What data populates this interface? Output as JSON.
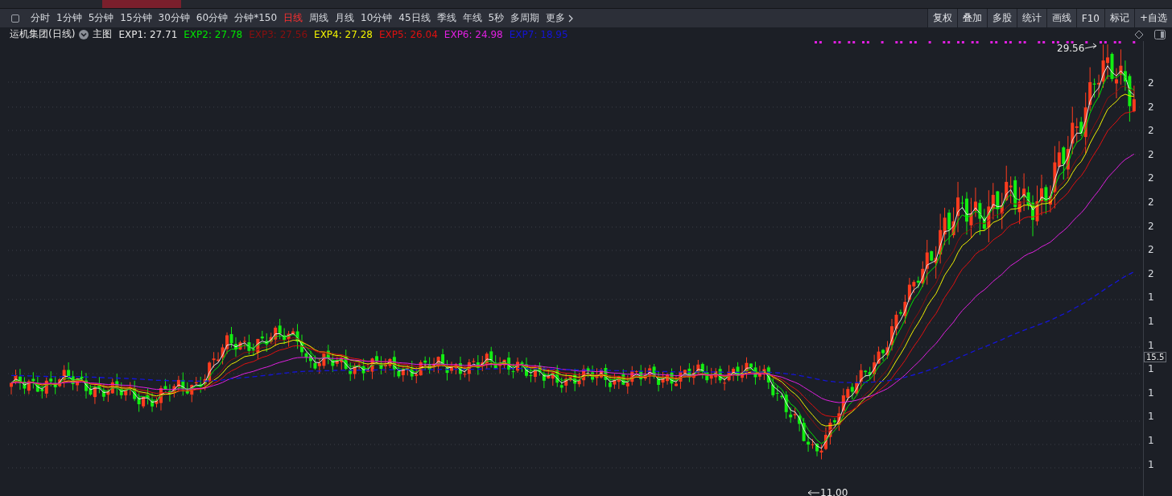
{
  "toolbar": {
    "periods": [
      {
        "label": "分时",
        "selected": false
      },
      {
        "label": "1分钟",
        "selected": false
      },
      {
        "label": "5分钟",
        "selected": false
      },
      {
        "label": "15分钟",
        "selected": false
      },
      {
        "label": "30分钟",
        "selected": false
      },
      {
        "label": "60分钟",
        "selected": false
      },
      {
        "label": "分钟*150",
        "selected": false
      },
      {
        "label": "日线",
        "selected": true
      },
      {
        "label": "周线",
        "selected": false
      },
      {
        "label": "月线",
        "selected": false
      },
      {
        "label": "10分钟",
        "selected": false
      },
      {
        "label": "45日线",
        "selected": false
      },
      {
        "label": "季线",
        "selected": false
      },
      {
        "label": "年线",
        "selected": false
      },
      {
        "label": "5秒",
        "selected": false
      },
      {
        "label": "多周期",
        "selected": false
      }
    ],
    "more": "更多",
    "buttons": [
      "复权",
      "叠加",
      "多股",
      "统计",
      "画线",
      "F10",
      "标记",
      "+自选"
    ]
  },
  "legend": {
    "title": "运机集团(日线)",
    "chart_label": "主图",
    "indicators": [
      {
        "text": "EXP1: 27.71",
        "color": "#e6e6e6"
      },
      {
        "text": "EXP2: 27.78",
        "color": "#00e600"
      },
      {
        "text": "EXP3: 27.56",
        "color": "#8a0f0f"
      },
      {
        "text": "EXP4: 27.28",
        "color": "#f0f000"
      },
      {
        "text": "EXP5: 26.04",
        "color": "#e01010"
      },
      {
        "text": "EXP6: 24.98",
        "color": "#e020e0"
      },
      {
        "text": "EXP7: 18.95",
        "color": "#1414d8"
      }
    ]
  },
  "chart": {
    "high_label": "29.56",
    "low_label": "11.00",
    "current_price": "15.5",
    "axis_labels": [
      "2",
      "2",
      "2",
      "2",
      "2",
      "2",
      "2",
      "2",
      "2",
      "1",
      "1",
      "1",
      "1",
      "1",
      "1",
      "1",
      "1"
    ]
  }
}
